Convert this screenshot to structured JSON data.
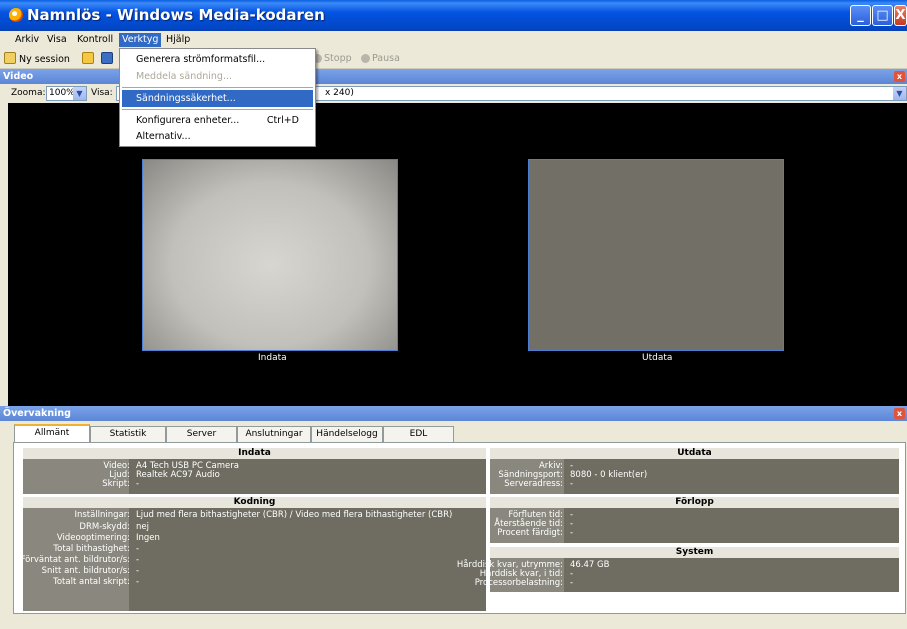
{
  "window": {
    "title": "Namnlös - Windows Media-kodaren",
    "controls": [
      "_",
      "□",
      "X"
    ]
  },
  "menubar": {
    "items": [
      "Arkiv",
      "Visa",
      "Kontroll",
      "Verktyg",
      "Hjälp"
    ],
    "active": "Verktyg"
  },
  "toolbar": {
    "new_session": "Ny session",
    "stop": "Stopp",
    "pause": "Pausa"
  },
  "dropdown": {
    "items": [
      {
        "label": "Generera strömformatsfil...",
        "shortcut": "",
        "state": "normal"
      },
      {
        "label": "Meddela sändning...",
        "shortcut": "",
        "state": "disabled"
      },
      {
        "label": "Sändningssäkerhet...",
        "shortcut": "",
        "state": "highlighted"
      },
      {
        "label": "Konfigurera enheter...",
        "shortcut": "Ctrl+D",
        "state": "normal"
      },
      {
        "label": "Alternativ...",
        "shortcut": "",
        "state": "normal"
      }
    ]
  },
  "video_pane": {
    "title": "Video",
    "zoom_label": "Zooma:",
    "zoom_value": "100%",
    "view_label": "Visa:",
    "view_value": "x 240)",
    "input_caption": "Indata",
    "output_caption": "Utdata"
  },
  "monitor": {
    "title": "Övervakning",
    "tabs": [
      "Allmänt",
      "Statistik",
      "Server",
      "Anslutningar",
      "Händelselogg",
      "EDL"
    ],
    "active_tab": "Allmänt",
    "indata": {
      "title": "Indata",
      "rows": [
        {
          "label": "Video:",
          "value": "A4 Tech USB PC Camera"
        },
        {
          "label": "Ljud:",
          "value": "Realtek AC97 Audio"
        },
        {
          "label": "Skript:",
          "value": "-"
        }
      ]
    },
    "kodning": {
      "title": "Kodning",
      "rows": [
        {
          "label": "Inställningar:",
          "value": "Ljud med flera bithastigheter (CBR) / Video med flera bithastigheter (CBR)"
        },
        {
          "label": "DRM-skydd:",
          "value": "nej"
        },
        {
          "label": "Videooptimering:",
          "value": "Ingen"
        },
        {
          "label": "Total bithastighet:",
          "value": "-"
        },
        {
          "label": "Förväntat ant. bildrutor/s:",
          "value": "-"
        },
        {
          "label": "Snitt ant. bildrutor/s:",
          "value": "-"
        },
        {
          "label": "Totalt antal skript:",
          "value": "-"
        }
      ]
    },
    "utdata": {
      "title": "Utdata",
      "rows": [
        {
          "label": "Arkiv:",
          "value": "-"
        },
        {
          "label": "Sändningsport:",
          "value": "8080 - 0 klient(er)"
        },
        {
          "label": "Serveradress:",
          "value": "-"
        }
      ]
    },
    "forlopp": {
      "title": "Förlopp",
      "rows": [
        {
          "label": "Förfluten tid:",
          "value": "-"
        },
        {
          "label": "Återstående tid:",
          "value": "-"
        },
        {
          "label": "Procent färdigt:",
          "value": "-"
        }
      ]
    },
    "system": {
      "title": "System",
      "rows": [
        {
          "label": "Hårddisk kvar, utrymme:",
          "value": "46.47 GB"
        },
        {
          "label": "Hårddisk kvar, i tid:",
          "value": "-"
        },
        {
          "label": "Processorbelastning:",
          "value": "-"
        }
      ]
    }
  },
  "colors": {
    "titlebar": "#0453e2",
    "highlight": "#316ac5",
    "panel": "#6f6d62"
  }
}
